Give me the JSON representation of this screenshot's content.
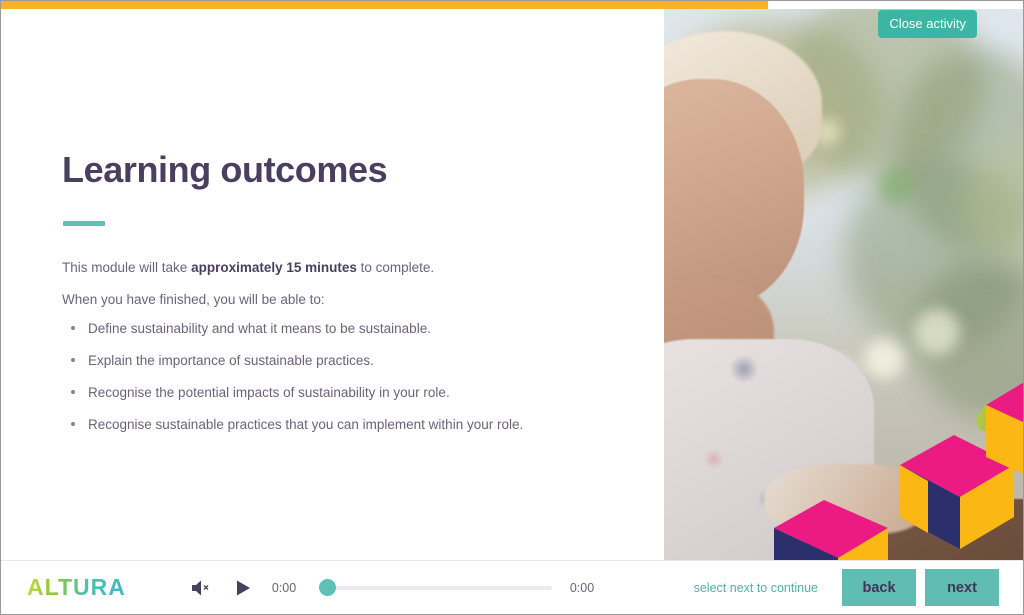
{
  "window": {
    "progress_percent": 75,
    "progress_color": "#f5b324"
  },
  "overlay": {
    "close_activity_label": "Close activity",
    "close_activity_bg": "#3bb5a4"
  },
  "slide": {
    "title": "Learning outcomes",
    "accent_color": "#5fc0b6",
    "title_color": "#4a3f5e",
    "intro_prefix": "This module will take ",
    "intro_bold": "approximately 15 minutes",
    "intro_suffix": " to complete.",
    "intro_second": "When you have finished, you will be able to:",
    "outcomes": [
      "Define sustainability and what it means to be sustainable.",
      "Explain the importance of sustainable practices.",
      "Recognise the potential impacts of sustainability in your role.",
      "Recognise sustainable practices that you can implement within your role."
    ]
  },
  "media": {
    "description": "Sunlit photo of an older woman smiling while holding a box in a garden, overlaid with magenta and yellow isometric cube graphics",
    "cube_pink": "#ec1b84",
    "cube_yellow": "#fbb713",
    "cube_navy": "#2b2f6b"
  },
  "footer": {
    "logo_text": "ALTURA",
    "mute_icon": "speaker-muted-icon",
    "play_icon": "play-icon",
    "time_elapsed": "0:00",
    "time_total": "0:00",
    "slider_value": 0,
    "hint_text": "select next to continue",
    "hint_color": "#4db3a8",
    "back_label": "back",
    "next_label": "next",
    "button_color": "#5fbdb4"
  }
}
